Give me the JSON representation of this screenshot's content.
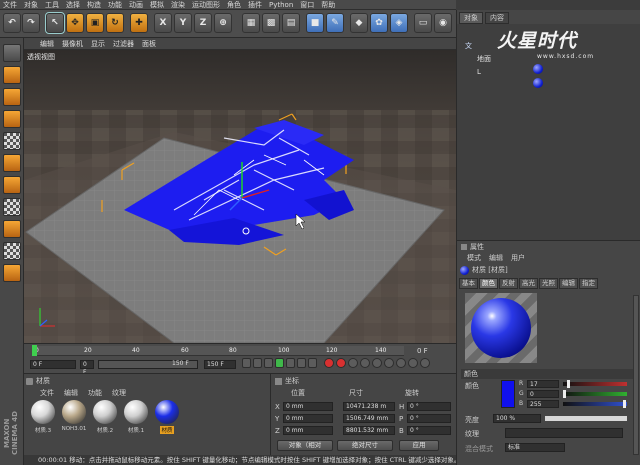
{
  "menu": [
    "文件",
    "对象",
    "工具",
    "选择",
    "构造",
    "功能",
    "动画",
    "模拟",
    "渲染",
    "运动图形",
    "角色",
    "插件",
    "Python",
    "窗口",
    "帮助"
  ],
  "toolbar": {
    "buttons": [
      {
        "name": "undo-icon",
        "glyph": "↶",
        "style": ""
      },
      {
        "name": "redo-icon",
        "glyph": "↷",
        "style": ""
      },
      {
        "name": "select-tool-icon",
        "glyph": "↖",
        "style": "sel"
      },
      {
        "name": "move-tool-icon",
        "glyph": "✥",
        "style": "orange"
      },
      {
        "name": "scale-tool-icon",
        "glyph": "▣",
        "style": "orange"
      },
      {
        "name": "rotate-tool-icon",
        "glyph": "↻",
        "style": "orange"
      },
      {
        "name": "add-icon",
        "glyph": "✚",
        "style": "orange"
      },
      {
        "name": "x-axis-icon",
        "glyph": "X",
        "style": ""
      },
      {
        "name": "y-axis-icon",
        "glyph": "Y",
        "style": ""
      },
      {
        "name": "z-axis-icon",
        "glyph": "Z",
        "style": ""
      },
      {
        "name": "coord-system-icon",
        "glyph": "⊕",
        "style": ""
      },
      {
        "name": "render-view-icon",
        "glyph": "▦",
        "style": ""
      },
      {
        "name": "render-picture-icon",
        "glyph": "▩",
        "style": ""
      },
      {
        "name": "render-settings-icon",
        "glyph": "▤",
        "style": ""
      },
      {
        "name": "cube-icon",
        "glyph": "■",
        "style": "blue"
      },
      {
        "name": "pen-icon",
        "glyph": "✎",
        "style": "blue"
      },
      {
        "name": "subdivision-icon",
        "glyph": "◆",
        "style": ""
      },
      {
        "name": "array-icon",
        "glyph": "✿",
        "style": "blue"
      },
      {
        "name": "deformer-icon",
        "glyph": "◈",
        "style": "blue"
      },
      {
        "name": "floor-icon",
        "glyph": "▭",
        "style": ""
      },
      {
        "name": "camera-icon",
        "glyph": "◉",
        "style": ""
      },
      {
        "name": "light-icon",
        "glyph": "☀",
        "style": ""
      }
    ]
  },
  "viewport": {
    "menu": [
      "编辑",
      "摄像机",
      "显示",
      "过滤器",
      "面板"
    ],
    "label": "透视视图"
  },
  "timeline": {
    "ticks": [
      "0",
      "20",
      "40",
      "60",
      "80",
      "100",
      "120",
      "140"
    ],
    "end_label": "0 F",
    "start_field": "0 F",
    "current_field": "0 F",
    "range_field": "150 F",
    "end_field": "150 F"
  },
  "materials": {
    "menu": [
      "文件",
      "编辑",
      "功能",
      "纹理"
    ],
    "header": "材质",
    "items": [
      {
        "label": "材质.3",
        "color": "#d8d8d8"
      },
      {
        "label": "NOH3.01",
        "color": "#b9a88a"
      },
      {
        "label": "材质.2",
        "color": "#cfcfcf"
      },
      {
        "label": "材质.1",
        "color": "#d0d0d0"
      },
      {
        "label": "材质",
        "color": "#1b2ee8"
      }
    ]
  },
  "coords": {
    "header": "坐标",
    "col_position": "位置",
    "col_size": "尺寸",
    "col_rotation": "旋转",
    "rows": [
      {
        "axis": "X",
        "pos": "0 mm",
        "size": "10471.238 m",
        "rot_axis": "H",
        "rot": "0 °"
      },
      {
        "axis": "Y",
        "pos": "0 mm",
        "size": "1506.749 mm",
        "rot_axis": "P",
        "rot": "0 °"
      },
      {
        "axis": "Z",
        "pos": "0 mm",
        "size": "8801.532 mm",
        "rot_axis": "B",
        "rot": "0 °"
      }
    ],
    "mode_select": "对象（相对",
    "size_select": "绝对尺寸",
    "apply_label": "应用"
  },
  "status": "00:00:01  移动：点击并拖动鼠标移动元素。按住 SHIFT 键量化移动；节点编辑模式时按住 SHIFT 键增加选择对象；按住 CTRL 键减少选择对象。",
  "objects": {
    "tabs": [
      "对象",
      "内容"
    ],
    "items": [
      {
        "label": "文",
        "color": "#cfe0ff"
      },
      {
        "label": "地面",
        "color": "#e0e0e0"
      },
      {
        "label": "L",
        "color": "#e0e0e0"
      }
    ]
  },
  "watermark": {
    "brand": "火星时代",
    "url": "www.hxsd.com"
  },
  "attributes": {
    "title": "属性",
    "menu": [
      "模式",
      "编辑",
      "用户"
    ],
    "material_name": "材质 [材质]",
    "tabs": [
      "基本",
      "颜色",
      "反射",
      "高光",
      "光照",
      "编辑",
      "指定"
    ],
    "active_tab": "颜色",
    "section": "颜色",
    "color_label": "颜色",
    "color_hex": "#1010ee",
    "r_label": "R",
    "r_value": "17",
    "g_label": "G",
    "g_value": "0",
    "b_label": "B",
    "b_value": "255",
    "brightness_label": "亮度",
    "brightness_value": "100 %",
    "brightness_fraction": 1.0,
    "texture_label": "纹理",
    "mix_mode_label": "混合模式",
    "mix_mode_value": "标准"
  },
  "left_tools": [
    {
      "name": "make-editable-icon",
      "style": ""
    },
    {
      "name": "model-mode-icon",
      "style": "o"
    },
    {
      "name": "texture-mode-icon",
      "style": "o"
    },
    {
      "name": "workplane-icon",
      "style": "o"
    },
    {
      "name": "points-mode-icon",
      "style": "c"
    },
    {
      "name": "edges-mode-icon",
      "style": "o"
    },
    {
      "name": "polygons-mode-icon",
      "style": "o"
    },
    {
      "name": "axis-mode-icon",
      "style": "c"
    },
    {
      "name": "snap-icon",
      "style": "o"
    },
    {
      "name": "lock-icon",
      "style": "c"
    },
    {
      "name": "layer-icon",
      "style": "o"
    }
  ],
  "brand_vertical": "MAXON CINEMA 4D"
}
